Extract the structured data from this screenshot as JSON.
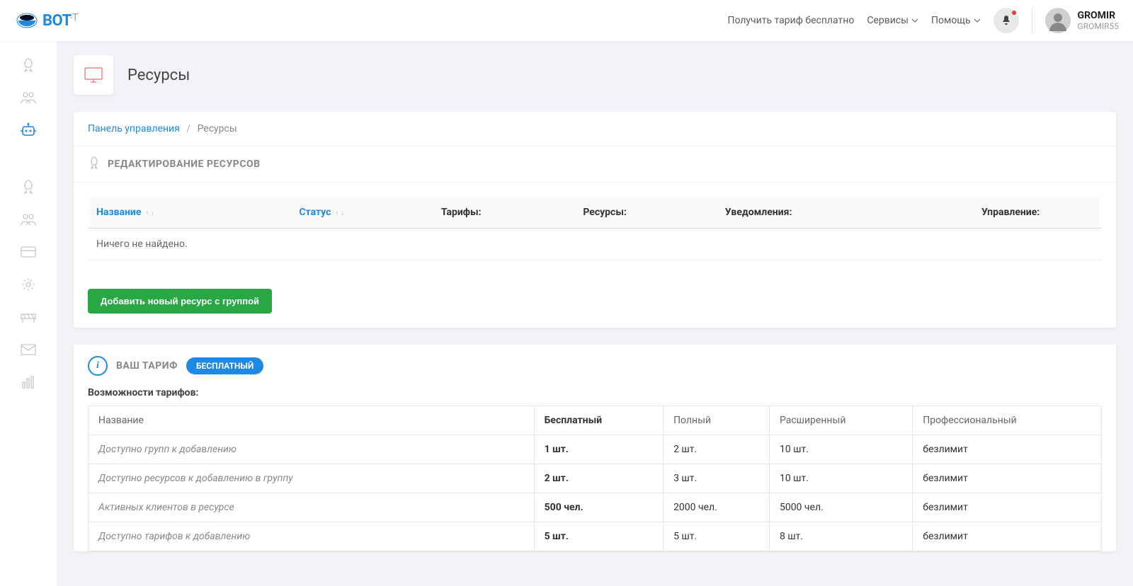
{
  "header": {
    "nav": {
      "get_tariff": "Получить тариф бесплатно",
      "services": "Сервисы",
      "help": "Помощь"
    },
    "user": {
      "name": "GROMIR",
      "sub": "GROMIR55"
    }
  },
  "page": {
    "title": "Ресурсы"
  },
  "breadcrumb": {
    "root": "Панель управления",
    "current": "Ресурсы"
  },
  "edit_card": {
    "title": "РЕДАКТИРОВАНИЕ РЕСУРСОВ",
    "columns": {
      "name": "Название",
      "status": "Статус",
      "tariffs": "Тарифы:",
      "resources": "Ресурсы:",
      "notifications": "Уведомления:",
      "manage": "Управление:"
    },
    "empty": "Ничего не найдено.",
    "add_button": "Добавить новый ресурс с группой"
  },
  "tariff_card": {
    "title": "ВАШ ТАРИФ",
    "badge": "БЕСПЛАТНЫЙ",
    "subtitle": "Возможности тарифов:",
    "cols": {
      "name": "Название",
      "free": "Бесплатный",
      "full": "Полный",
      "extended": "Расширенный",
      "pro": "Профессиональный"
    },
    "rows": [
      {
        "label": "Доступно групп к добавлению",
        "free": "1 шт.",
        "full": "2 шт.",
        "ext": "10 шт.",
        "pro": "безлимит"
      },
      {
        "label": "Доступно ресурсов к добавлению в группу",
        "free": "2 шт.",
        "full": "3 шт.",
        "ext": "10 шт.",
        "pro": "безлимит"
      },
      {
        "label": "Активных клиентов в ресурсе",
        "free": "500 чел.",
        "full": "2000 чел.",
        "ext": "5000 чел.",
        "pro": "безлимит"
      },
      {
        "label": "Доступно тарифов к добавлению",
        "free": "5 шт.",
        "full": "5 шт.",
        "ext": "8 шт.",
        "pro": "безлимит"
      }
    ]
  }
}
